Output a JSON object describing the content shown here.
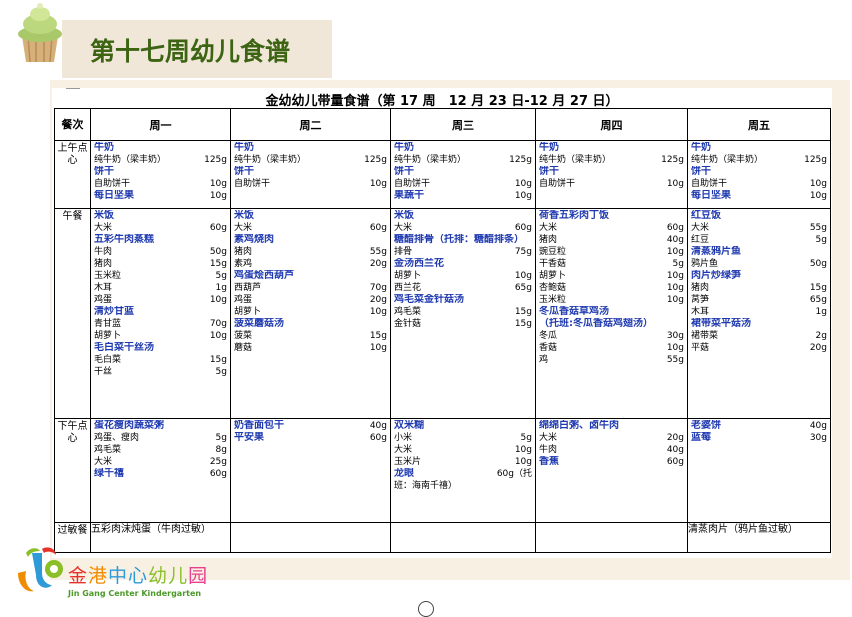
{
  "header": {
    "title": "第十七周幼儿食谱"
  },
  "doc": {
    "title": "金幼幼儿带量食谱（第 17 周　12 月 23 日-12 月 27 日）"
  },
  "table": {
    "corner_label": "餐次",
    "days": [
      "周一",
      "周二",
      "周三",
      "周四",
      "周五"
    ],
    "meals": [
      {
        "label": "上午点心",
        "cells": [
          [
            {
              "t": "dish",
              "name": "牛奶"
            },
            {
              "t": "ing",
              "name": "纯牛奶（梁丰奶）",
              "amt": "125g"
            },
            {
              "t": "dish",
              "name": "饼干"
            },
            {
              "t": "ing",
              "name": "自助饼干",
              "amt": "10g"
            },
            {
              "t": "dish",
              "name": "每日坚果",
              "amt": "10g"
            }
          ],
          [
            {
              "t": "dish",
              "name": "牛奶"
            },
            {
              "t": "ing",
              "name": "纯牛奶（梁丰奶）",
              "amt": "125g"
            },
            {
              "t": "dish",
              "name": "饼干"
            },
            {
              "t": "ing",
              "name": "自助饼干",
              "amt": "10g"
            }
          ],
          [
            {
              "t": "dish",
              "name": "牛奶"
            },
            {
              "t": "ing",
              "name": "纯牛奶（梁丰奶）",
              "amt": "125g"
            },
            {
              "t": "dish",
              "name": "饼干"
            },
            {
              "t": "ing",
              "name": "自助饼干",
              "amt": "10g"
            },
            {
              "t": "dish",
              "name": "果蔬干",
              "amt": "10g"
            }
          ],
          [
            {
              "t": "dish",
              "name": "牛奶"
            },
            {
              "t": "ing",
              "name": "纯牛奶（梁丰奶）",
              "amt": "125g"
            },
            {
              "t": "dish",
              "name": "饼干"
            },
            {
              "t": "ing",
              "name": "自助饼干",
              "amt": "10g"
            }
          ],
          [
            {
              "t": "dish",
              "name": "牛奶"
            },
            {
              "t": "ing",
              "name": "纯牛奶（梁丰奶）",
              "amt": "125g"
            },
            {
              "t": "dish",
              "name": "饼干"
            },
            {
              "t": "ing",
              "name": "自助饼干",
              "amt": "10g"
            },
            {
              "t": "dish",
              "name": "每日坚果",
              "amt": "10g"
            }
          ]
        ]
      },
      {
        "label": "午餐",
        "cells": [
          [
            {
              "t": "dish",
              "name": "米饭"
            },
            {
              "t": "ing",
              "name": "大米",
              "amt": "60g"
            },
            {
              "t": "dish",
              "name": "五彩牛肉蒸糕"
            },
            {
              "t": "ing",
              "name": "牛肉",
              "amt": "50g"
            },
            {
              "t": "ing",
              "name": "猪肉",
              "amt": "15g"
            },
            {
              "t": "ing",
              "name": "玉米粒",
              "amt": "5g"
            },
            {
              "t": "ing",
              "name": "木耳",
              "amt": "1g"
            },
            {
              "t": "ing",
              "name": "鸡蛋",
              "amt": "10g"
            },
            {
              "t": "dish",
              "name": "清炒甘蓝"
            },
            {
              "t": "ing",
              "name": "青甘蓝",
              "amt": "70g"
            },
            {
              "t": "ing",
              "name": "胡萝卜",
              "amt": "10g"
            },
            {
              "t": "dish",
              "name": "毛白菜干丝汤"
            },
            {
              "t": "ing",
              "name": "毛白菜",
              "amt": "15g"
            },
            {
              "t": "ing",
              "name": "干丝",
              "amt": "5g"
            }
          ],
          [
            {
              "t": "dish",
              "name": "米饭"
            },
            {
              "t": "ing",
              "name": "大米",
              "amt": "60g"
            },
            {
              "t": "dish",
              "name": "素鸡烧肉"
            },
            {
              "t": "ing",
              "name": "猪肉",
              "amt": "55g"
            },
            {
              "t": "ing",
              "name": "素鸡",
              "amt": "20g"
            },
            {
              "t": "dish",
              "name": "鸡蛋烩西葫芦"
            },
            {
              "t": "ing",
              "name": "西葫芦",
              "amt": "70g"
            },
            {
              "t": "ing",
              "name": "鸡蛋",
              "amt": "20g"
            },
            {
              "t": "ing",
              "name": "胡萝卜",
              "amt": "10g"
            },
            {
              "t": "dish",
              "name": "菠菜蘑菇汤"
            },
            {
              "t": "ing",
              "name": "菠菜",
              "amt": "15g"
            },
            {
              "t": "ing",
              "name": "蘑菇",
              "amt": "10g"
            }
          ],
          [
            {
              "t": "dish",
              "name": "米饭"
            },
            {
              "t": "ing",
              "name": "大米",
              "amt": "60g"
            },
            {
              "t": "dishwrap",
              "name": "糖醋排骨（托排：糖醋排条）"
            },
            {
              "t": "ing",
              "name": "排骨",
              "amt": "75g"
            },
            {
              "t": "dish",
              "name": "金汤西兰花"
            },
            {
              "t": "ing",
              "name": "胡萝卜",
              "amt": "10g"
            },
            {
              "t": "ing",
              "name": "西兰花",
              "amt": "65g"
            },
            {
              "t": "dish",
              "name": "鸡毛菜金针菇汤"
            },
            {
              "t": "ing",
              "name": "鸡毛菜",
              "amt": "15g"
            },
            {
              "t": "ing",
              "name": "金针菇",
              "amt": "15g"
            }
          ],
          [
            {
              "t": "dish",
              "name": "荷香五彩肉丁饭"
            },
            {
              "t": "ing",
              "name": "大米",
              "amt": "60g"
            },
            {
              "t": "ing",
              "name": "猪肉",
              "amt": "40g"
            },
            {
              "t": "ing",
              "name": "豌豆粒",
              "amt": "10g"
            },
            {
              "t": "ing",
              "name": "干香菇",
              "amt": "5g"
            },
            {
              "t": "ing",
              "name": "胡萝卜",
              "amt": "10g"
            },
            {
              "t": "ing",
              "name": "杏鲍菇",
              "amt": "10g"
            },
            {
              "t": "ing",
              "name": "玉米粒",
              "amt": "10g"
            },
            {
              "t": "dish",
              "name": "冬瓜香菇草鸡汤"
            },
            {
              "t": "dish",
              "name": "（托班:冬瓜香菇鸡翅汤）"
            },
            {
              "t": "ing",
              "name": "冬瓜",
              "amt": "30g"
            },
            {
              "t": "ing",
              "name": "香菇",
              "amt": "10g"
            },
            {
              "t": "ing",
              "name": "鸡",
              "amt": "55g"
            }
          ],
          [
            {
              "t": "dish",
              "name": "红豆饭"
            },
            {
              "t": "ing",
              "name": "大米",
              "amt": "55g"
            },
            {
              "t": "ing",
              "name": "红豆",
              "amt": "5g"
            },
            {
              "t": "dish",
              "name": "清蒸鸦片鱼"
            },
            {
              "t": "ing",
              "name": "鸦片鱼",
              "amt": "50g"
            },
            {
              "t": "dish",
              "name": "肉片炒绿笋"
            },
            {
              "t": "ing",
              "name": "猪肉",
              "amt": "15g"
            },
            {
              "t": "ing",
              "name": "莴笋",
              "amt": "65g"
            },
            {
              "t": "ing",
              "name": "木耳",
              "amt": "1g"
            },
            {
              "t": "dish",
              "name": "裙带菜平菇汤"
            },
            {
              "t": "ing",
              "name": "裙带菜",
              "amt": "2g"
            },
            {
              "t": "ing",
              "name": "平菇",
              "amt": "20g"
            }
          ]
        ]
      },
      {
        "label": "下午点心",
        "cells": [
          [
            {
              "t": "dish",
              "name": "蛋花瘦肉蔬菜粥"
            },
            {
              "t": "ing",
              "name": "鸡蛋、瘦肉",
              "amt": "5g"
            },
            {
              "t": "ing",
              "name": "鸡毛菜",
              "amt": "8g"
            },
            {
              "t": "ing",
              "name": "大米",
              "amt": "25g"
            },
            {
              "t": "dish",
              "name": "绿千禧",
              "amt": "60g"
            }
          ],
          [
            {
              "t": "dish",
              "name": "奶香面包干",
              "amt": "40g"
            },
            {
              "t": "dish",
              "name": "平安果",
              "amt": "60g"
            }
          ],
          [
            {
              "t": "dish",
              "name": "双米糊"
            },
            {
              "t": "ing",
              "name": "小米",
              "amt": "5g"
            },
            {
              "t": "ing",
              "name": "大米",
              "amt": "10g"
            },
            {
              "t": "ing",
              "name": "玉米片",
              "amt": "10g"
            },
            {
              "t": "dish",
              "name": "龙眼",
              "amt": "60g（托"
            },
            {
              "t": "ing",
              "name": "班：海南千禧）"
            }
          ],
          [
            {
              "t": "dish",
              "name": "绵绵白粥、卤牛肉"
            },
            {
              "t": "ing",
              "name": "大米",
              "amt": "20g"
            },
            {
              "t": "ing",
              "name": "牛肉",
              "amt": "40g"
            },
            {
              "t": "dish",
              "name": "香蕉",
              "amt": "60g"
            }
          ],
          [
            {
              "t": "dish",
              "name": "老婆饼",
              "amt": "40g"
            },
            {
              "t": "dish",
              "name": "蓝莓",
              "amt": "30g"
            }
          ]
        ]
      },
      {
        "label": "过敏餐",
        "cells": [
          "五彩肉沫炖蛋（牛肉过敏）",
          "",
          "",
          "",
          "清蒸肉片（鸦片鱼过敏）"
        ]
      }
    ]
  },
  "logo": {
    "cn": [
      "金",
      "港",
      "中",
      "心",
      "幼",
      "儿",
      "园"
    ],
    "cn_colors": [
      "#e5332a",
      "#f08c00",
      "#2e9ad8",
      "#2e9ad8",
      "#8bbf27",
      "#8bbf27",
      "#e8408c"
    ],
    "en": "Jin Gang Center Kindergarten"
  },
  "colors": {
    "dish": "#1f3ab0",
    "title_green": "#3c6413",
    "panel": "#f9f0e4"
  }
}
